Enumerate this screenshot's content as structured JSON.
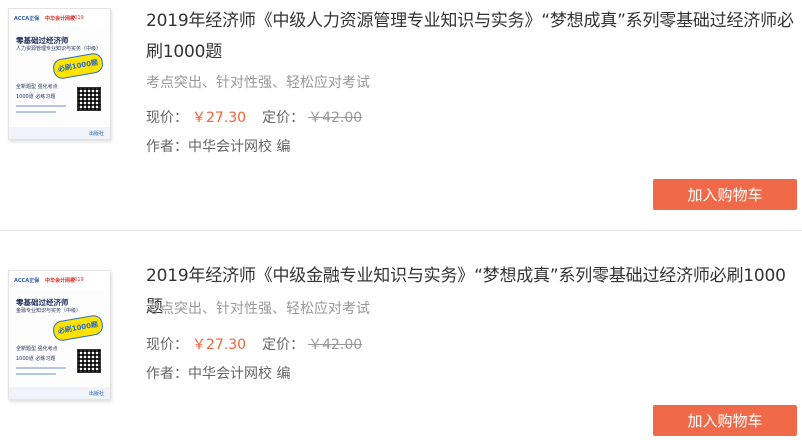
{
  "colors": {
    "price": "#f4623a",
    "button": "#f06a4a",
    "muted": "#999999"
  },
  "products": [
    {
      "title": "2019年经济师《中级人力资源管理专业知识与实务》“梦想成真”系列零基础过经济师必刷1000题",
      "subtitle": "考点突出、针对性强、轻松应对考试",
      "price_label": "现价：",
      "price": "￥27.30",
      "list_label": "定价：",
      "list_price": "￥42.00",
      "author": "作者：中华会计网校 编",
      "cart_label": "加入购物车",
      "cover": {
        "logo_a": "ACCA正保",
        "logo_b": "中华会计网校",
        "logo_c": "2019",
        "series": "零基础过经济师",
        "subtitle": "人力资源管理专业知识与实务（中级）",
        "badge": "必刷1000题",
        "line1": "全新题型 强化考点",
        "line2": "1000道 必练习题",
        "publisher": "出版社"
      }
    },
    {
      "title": "2019年经济师《中级金融专业知识与实务》“梦想成真”系列零基础过经济师必刷1000题",
      "subtitle": "考点突出、针对性强、轻松应对考试",
      "price_label": "现价：",
      "price": "￥27.30",
      "list_label": "定价：",
      "list_price": "￥42.00",
      "author": "作者：中华会计网校 编",
      "cart_label": "加入购物车",
      "cover": {
        "logo_a": "ACCA正保",
        "logo_b": "中华会计网校",
        "logo_c": "2019",
        "series": "零基础过经济师",
        "subtitle": "金融专业知识与实务（中级）",
        "badge": "必刷1000题",
        "line1": "全新题型 强化考点",
        "line2": "1000道 必练习题",
        "publisher": "出版社"
      }
    }
  ]
}
